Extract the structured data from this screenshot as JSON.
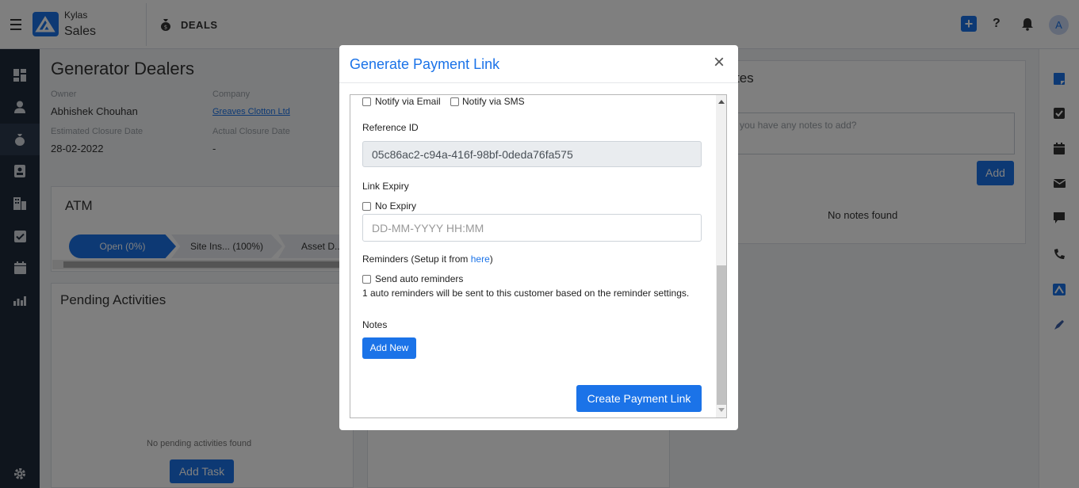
{
  "header": {
    "brand_top": "Kylas",
    "brand_bottom": "Sales",
    "module": "DEALS",
    "avatar_initial": "A",
    "help_symbol": "?",
    "plus_symbol": "+"
  },
  "deal": {
    "title": "Generator Dealers",
    "owner_label": "Owner",
    "owner_value": "Abhishek Chouhan",
    "company_label": "Company",
    "company_value": "Greaves Clotton Ltd",
    "est_close_label": "Estimated Closure Date",
    "est_close_value": "28-02-2022",
    "actual_close_label": "Actual Closure Date",
    "actual_close_value": "-"
  },
  "pipeline": {
    "title": "ATM",
    "stages": [
      "Open (0%)",
      "Site Ins...    (100%)",
      "Asset D..."
    ]
  },
  "activities": {
    "title": "Pending Activities",
    "empty": "No pending activities found",
    "add_label": "Add Task"
  },
  "notes_panel": {
    "title_fragment": "tes",
    "placeholder_fragment": "you have any notes to add?",
    "add_label": "Add",
    "empty": "No notes found"
  },
  "modal": {
    "title": "Generate Payment Link",
    "close_symbol": "×",
    "notify_email": "Notify via Email",
    "notify_sms": "Notify via SMS",
    "reference_label": "Reference ID",
    "reference_value": "05c86ac2-c94a-416f-98bf-0deda76fa575",
    "expiry_label": "Link Expiry",
    "no_expiry": "No Expiry",
    "expiry_placeholder": "DD-MM-YYYY HH:MM",
    "reminders_label": "Reminders (Setup it from ",
    "reminders_link": "here",
    "reminders_close": ")",
    "auto_reminders": "Send auto reminders",
    "reminder_info": "1 auto reminders will be sent to this customer based on the reminder settings.",
    "notes_label": "Notes",
    "add_new": "Add New",
    "create_button": "Create Payment Link"
  },
  "colors": {
    "accent": "#1b73e8",
    "sidebar": "#1f2b3a"
  }
}
